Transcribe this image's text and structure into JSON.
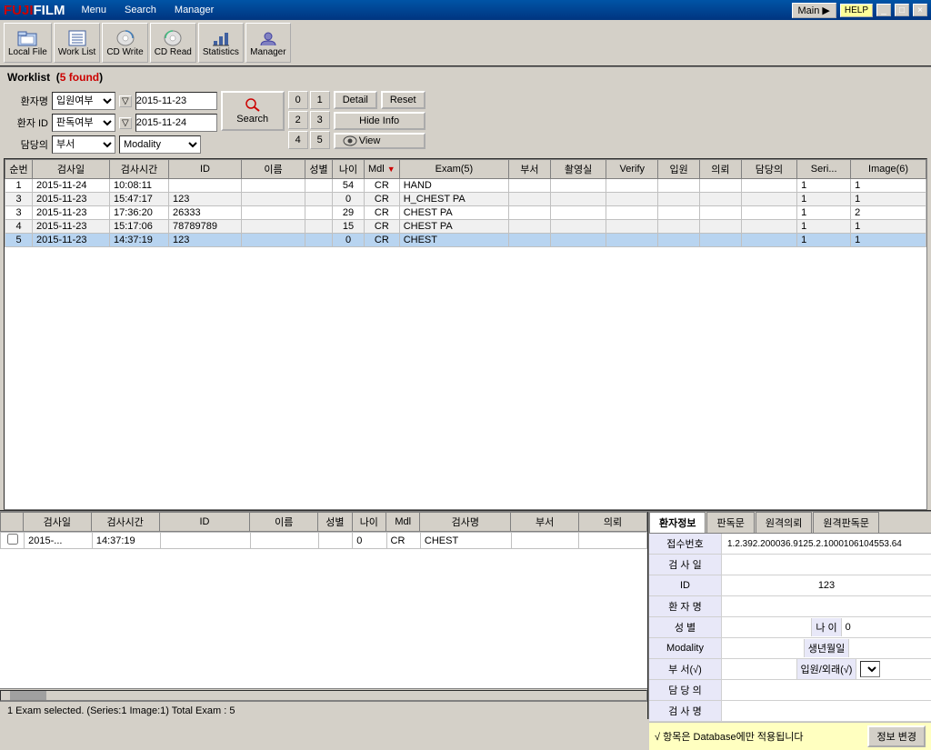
{
  "titlebar": {
    "logo": "FUJIFILM",
    "menus": [
      "Menu",
      "Search",
      "Manager"
    ],
    "main_btn": "Main ▶",
    "help_btn": "HELP",
    "minimize": "_",
    "restore": "□",
    "close": "×"
  },
  "toolbar": {
    "buttons": [
      {
        "id": "local-file",
        "label": "Local File",
        "icon": "📁"
      },
      {
        "id": "work-list",
        "label": "Work List",
        "icon": "📋"
      },
      {
        "id": "cd-write",
        "label": "CD Write",
        "icon": "💿"
      },
      {
        "id": "cd-read",
        "label": "CD Read",
        "icon": "💿"
      },
      {
        "id": "statistics",
        "label": "Statistics",
        "icon": "📊"
      },
      {
        "id": "manager",
        "label": "Manager",
        "icon": "⚙"
      }
    ]
  },
  "worklist": {
    "title": "Worklist",
    "found_text": "5 found",
    "filters": {
      "row1": {
        "label": "환자명",
        "type_label": "입원여부",
        "date": "2015-11-23"
      },
      "row2": {
        "label": "환자 ID",
        "type_label": "판독여부",
        "date": "2015-11-24"
      },
      "row3": {
        "label": "담당의",
        "type_label": "부서",
        "modality": "Modality"
      }
    },
    "num_buttons": [
      "0",
      "1",
      "2",
      "3",
      "4",
      "5"
    ],
    "search_label": "Search",
    "detail_label": "Detail",
    "reset_label": "Reset",
    "hide_info_label": "Hide Info",
    "view_label": "View",
    "columns": [
      "순번",
      "검사일",
      "검사시간",
      "ID",
      "이름",
      "성별",
      "나이",
      "Mdl",
      "Exam(5)",
      "부서",
      "촬영실",
      "Verify",
      "입원",
      "의뢰",
      "담당의",
      "Seri...",
      "Image(6)"
    ],
    "rows": [
      {
        "num": "1",
        "date": "2015-11-24",
        "time": "10:08:11",
        "id": "",
        "name": "",
        "gender": "",
        "age": "54",
        "mdl": "CR",
        "exam": "HAND",
        "dept": "",
        "room": "",
        "verify": "",
        "admit": "",
        "ref": "",
        "doctor": "",
        "series": "1",
        "images": "1"
      },
      {
        "num": "3",
        "date": "2015-11-23",
        "time": "15:47:17",
        "id": "123",
        "name": "",
        "gender": "",
        "age": "0",
        "mdl": "CR",
        "exam": "H_CHEST PA",
        "dept": "",
        "room": "",
        "verify": "",
        "admit": "",
        "ref": "",
        "doctor": "",
        "series": "1",
        "images": "1"
      },
      {
        "num": "3",
        "date": "2015-11-23",
        "time": "17:36:20",
        "id": "26333",
        "name": "",
        "gender": "",
        "age": "29",
        "mdl": "CR",
        "exam": "CHEST PA",
        "dept": "",
        "room": "",
        "verify": "",
        "admit": "",
        "ref": "",
        "doctor": "",
        "series": "1",
        "images": "2"
      },
      {
        "num": "4",
        "date": "2015-11-23",
        "time": "15:17:06",
        "id": "78789789",
        "name": "",
        "gender": "",
        "age": "15",
        "mdl": "CR",
        "exam": "CHEST PA",
        "dept": "",
        "room": "",
        "verify": "",
        "admit": "",
        "ref": "",
        "doctor": "",
        "series": "1",
        "images": "1"
      },
      {
        "num": "5",
        "date": "2015-11-23",
        "time": "14:37:19",
        "id": "123",
        "name": "",
        "gender": "",
        "age": "0",
        "mdl": "CR",
        "exam": "CHEST",
        "dept": "",
        "room": "",
        "verify": "",
        "admit": "",
        "ref": "",
        "doctor": "",
        "series": "1",
        "images": "1"
      }
    ]
  },
  "bottom_table": {
    "columns": [
      "",
      "검사일",
      "검사시간",
      "ID",
      "이름",
      "성별",
      "나이",
      "Mdl",
      "검사명",
      "부서",
      "의뢰"
    ],
    "rows": [
      {
        "checkbox": false,
        "date": "2015-...",
        "time": "14:37:19",
        "id": "",
        "name": "",
        "gender": "",
        "age": "0",
        "mdl": "CR",
        "exam": "CHEST",
        "dept": "",
        "ref": ""
      }
    ]
  },
  "patient_info": {
    "tabs": [
      "환자정보",
      "판독문",
      "원격의뢰",
      "원격판독문"
    ],
    "active_tab": "환자정보",
    "fields": {
      "accession": {
        "label": "접수번호",
        "value": "1.2.392.200036.9125.2.1000106104553.64"
      },
      "exam_date": {
        "label": "검 사 일",
        "value": ""
      },
      "id": {
        "label": "ID",
        "value": "123"
      },
      "patient_name": {
        "label": "환 자 명",
        "value": ""
      },
      "gender_label": "성   별",
      "gender_value": "",
      "age_label": "나  이",
      "age_value": "0",
      "modality_label": "Modality",
      "modality_value": "",
      "birthdate_label": "생년월일",
      "birthdate_value": "",
      "dept_label": "부  서(√)",
      "dept_value": "",
      "inout_label": "입원/외래(√)",
      "inout_value": "",
      "doctor_label": "담 당 의",
      "doctor_value": "",
      "exam_name_label": "검 사 명",
      "exam_name_value": ""
    },
    "note": "√ 항목은 Database에만 적용됩니다",
    "update_btn": "정보 변경"
  },
  "status_bar": {
    "text": "1 Exam selected. (Series:1 Image:1)  Total Exam : 5"
  }
}
